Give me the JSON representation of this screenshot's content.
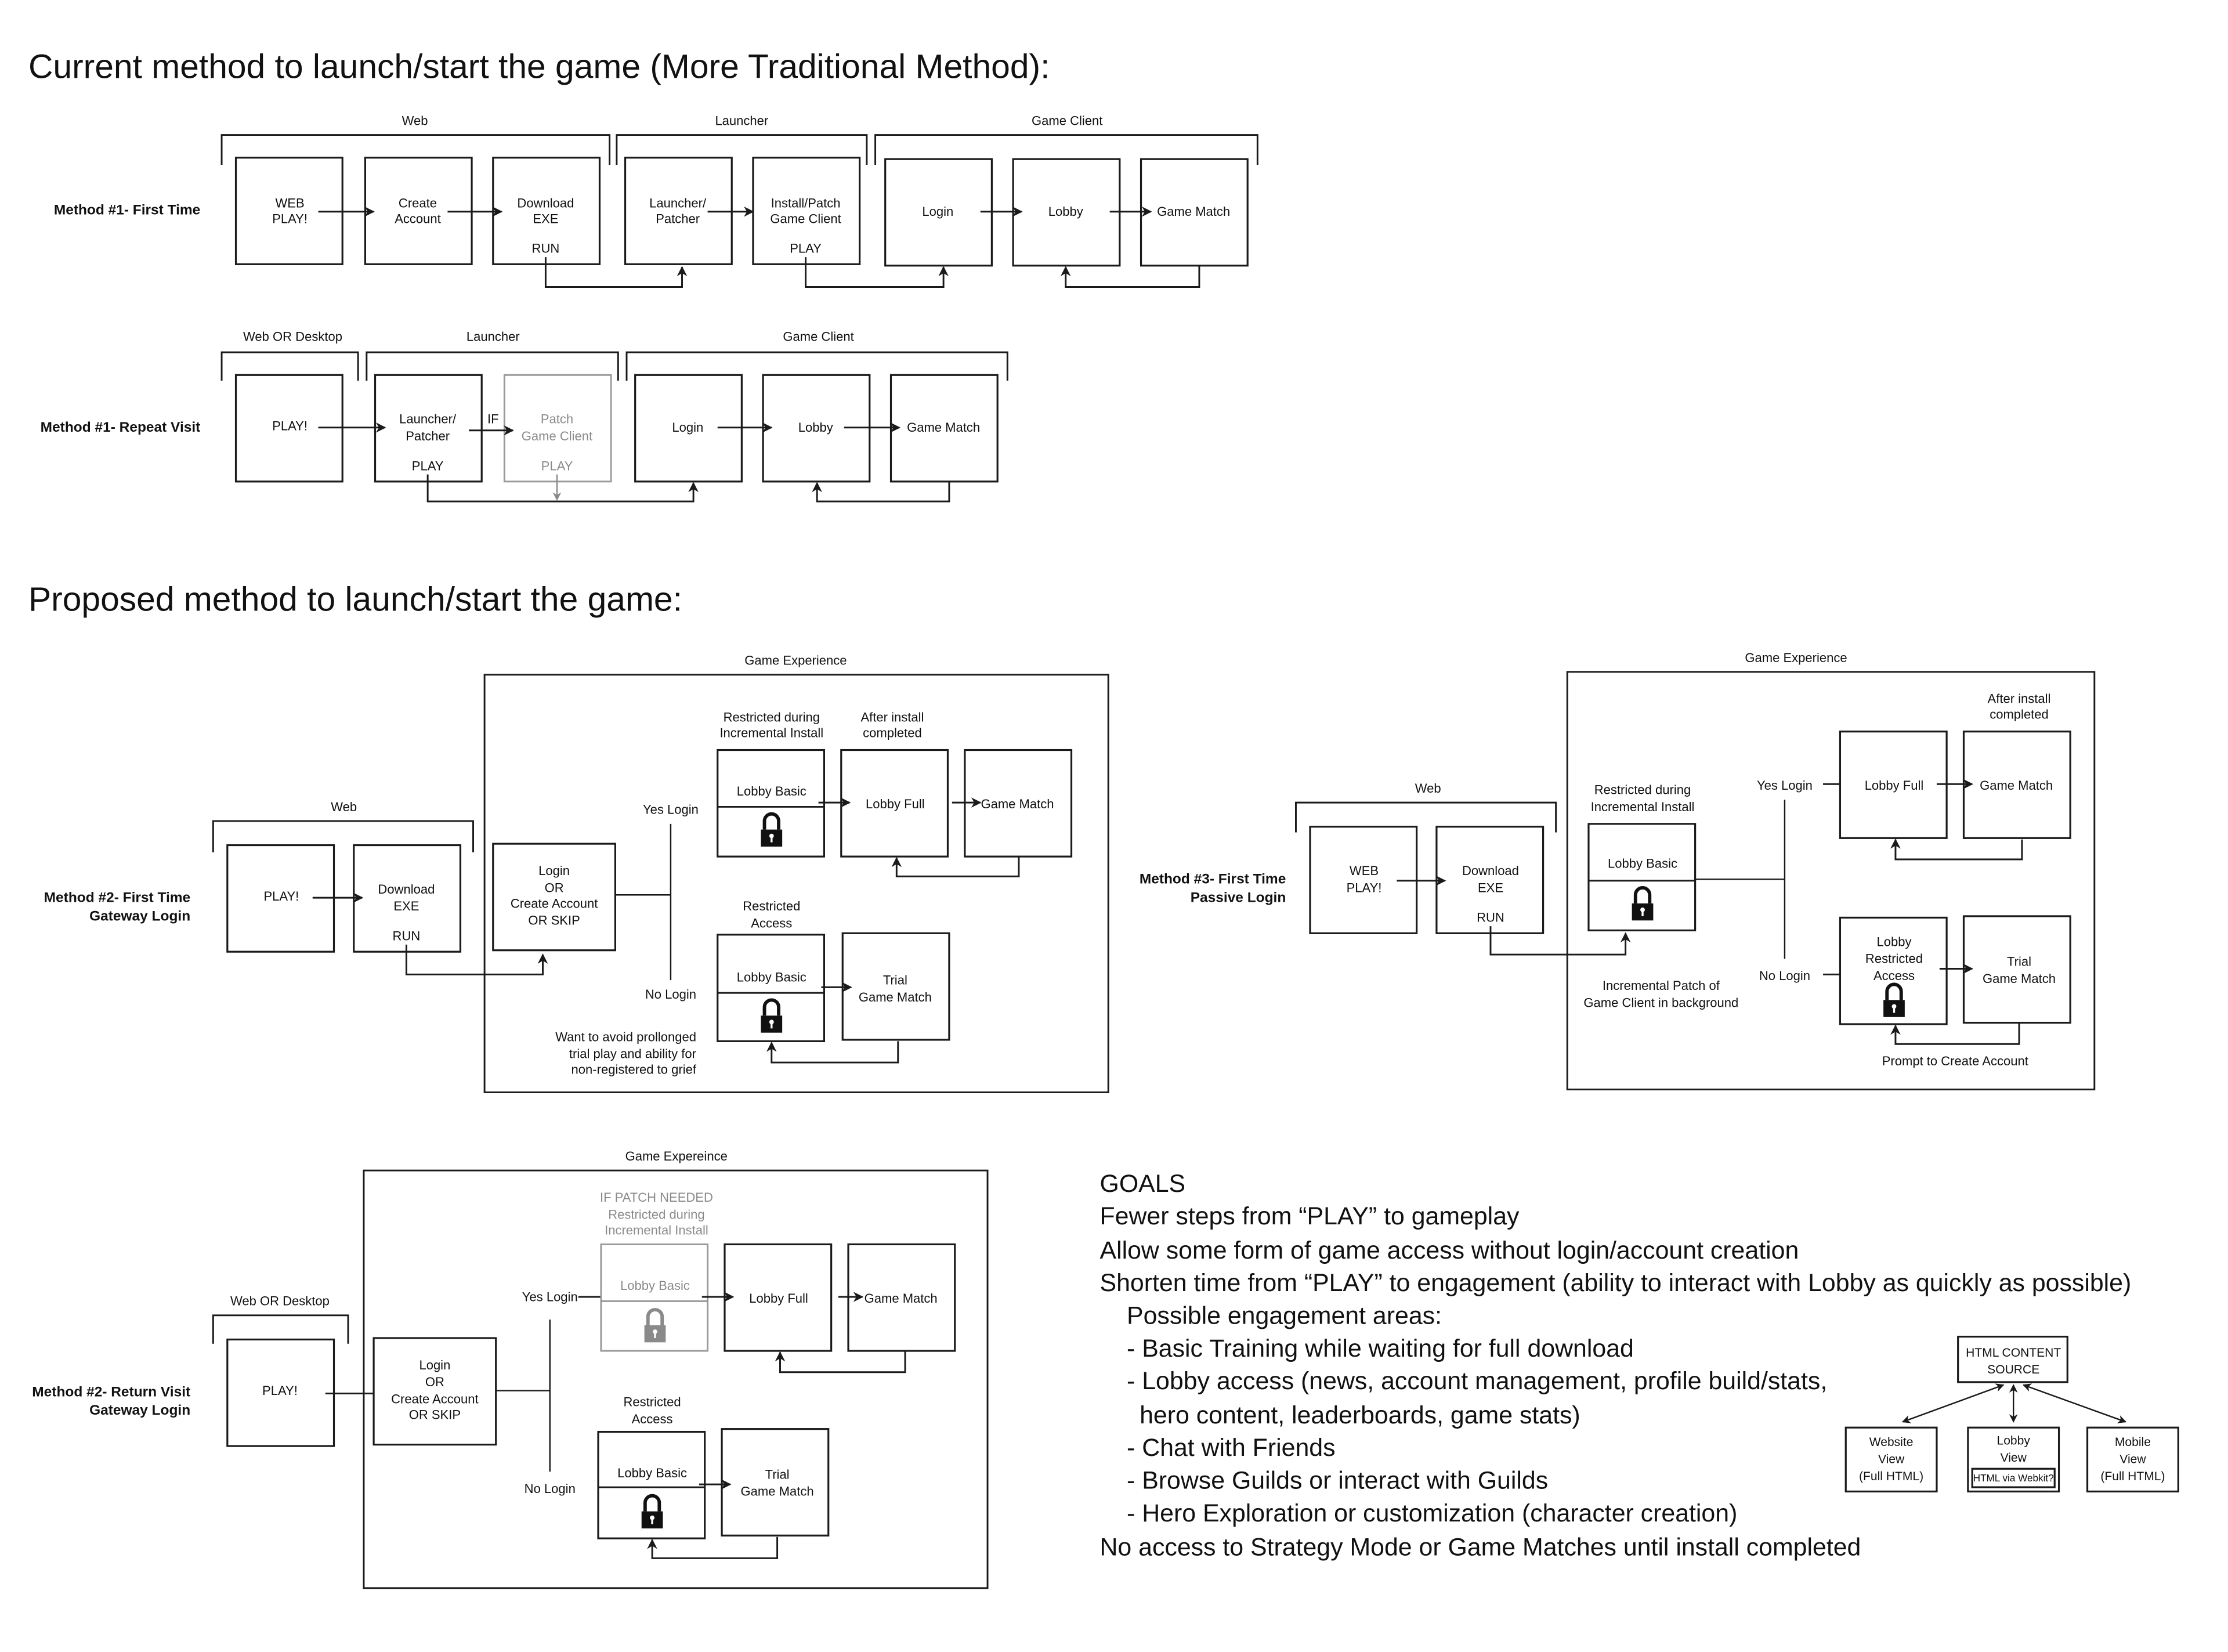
{
  "sections": {
    "current_title": "Current method to launch/start the game (More Traditional Method):",
    "proposed_title": "Proposed method to launch/start the game:"
  },
  "method1_first": {
    "label": "Method #1- First Time",
    "groups": [
      "Web",
      "Launcher",
      "Game Client"
    ],
    "boxes": [
      {
        "line1": "WEB",
        "line2": "PLAY!",
        "footer": ""
      },
      {
        "line1": "Create",
        "line2": "Account",
        "footer": ""
      },
      {
        "line1": "Download",
        "line2": "EXE",
        "footer": "RUN"
      },
      {
        "line1": "Launcher/",
        "line2": "Patcher",
        "footer": ""
      },
      {
        "line1": "Install/Patch",
        "line2": "Game Client",
        "footer": "PLAY"
      },
      {
        "line1": "Login",
        "line2": "",
        "footer": ""
      },
      {
        "line1": "Lobby",
        "line2": "",
        "footer": ""
      },
      {
        "line1": "Game Match",
        "line2": "",
        "footer": ""
      }
    ]
  },
  "method1_repeat": {
    "label": "Method #1- Repeat Visit",
    "groups": [
      "Web OR Desktop",
      "Launcher",
      "Game Client"
    ],
    "if_label": "IF",
    "boxes": [
      {
        "line1": "PLAY!",
        "line2": "",
        "footer": "",
        "dimmed": false
      },
      {
        "line1": "Launcher/",
        "line2": "Patcher",
        "footer": "PLAY",
        "dimmed": false
      },
      {
        "line1": "Patch",
        "line2": "Game Client",
        "footer": "PLAY",
        "dimmed": true
      },
      {
        "line1": "Login",
        "line2": "",
        "footer": "",
        "dimmed": false
      },
      {
        "line1": "Lobby",
        "line2": "",
        "footer": "",
        "dimmed": false
      },
      {
        "line1": "Game Match",
        "line2": "",
        "footer": "",
        "dimmed": false
      }
    ]
  },
  "method2_first": {
    "label_line1": "Method #2- First Time",
    "label_line2": "Gateway Login",
    "web_group": "Web",
    "experience_label": "Game Experience",
    "play": "PLAY!",
    "download": {
      "line1": "Download",
      "line2": "EXE",
      "footer": "RUN"
    },
    "login": {
      "lines": [
        "Login",
        "OR",
        "Create Account",
        "OR SKIP"
      ]
    },
    "yes_login": "Yes Login",
    "no_login": "No Login",
    "restricted_install": {
      "line1": "Restricted during",
      "line2": "Incremental Install"
    },
    "after_install": {
      "line1": "After install",
      "line2": "completed"
    },
    "restricted_access": {
      "line1": "Restricted",
      "line2": "Access"
    },
    "lobby_basic": "Lobby Basic",
    "lobby_full": "Lobby Full",
    "game_match": "Game Match",
    "trial": {
      "line1": "Trial",
      "line2": "Game Match"
    },
    "note": [
      "Want to avoid prollonged",
      "trial play and ability for",
      "non-registered to grief"
    ]
  },
  "method3_first": {
    "label_line1": "Method #3- First Time",
    "label_line2": "Passive Login",
    "web_group": "Web",
    "experience_label": "Game Experience",
    "web_play": {
      "line1": "WEB",
      "line2": "PLAY!"
    },
    "download": {
      "line1": "Download",
      "line2": "EXE",
      "footer": "RUN"
    },
    "restricted_install": {
      "line1": "Restricted during",
      "line2": "Incremental Install"
    },
    "lobby_basic": "Lobby Basic",
    "yes_login": "Yes Login",
    "no_login": "No Login",
    "after_install": {
      "line1": "After install",
      "line2": "completed"
    },
    "lobby_full": "Lobby Full",
    "game_match": "Game Match",
    "lobby_restricted": {
      "line1": "Lobby",
      "line2": "Restricted",
      "line3": "Access"
    },
    "trial": {
      "line1": "Trial",
      "line2": "Game Match"
    },
    "patch_note": {
      "line1": "Incremental Patch of",
      "line2": "Game Client in background"
    },
    "prompt": "Prompt to Create Account"
  },
  "method2_return": {
    "label_line1": "Method #2- Return Visit",
    "label_line2": "Gateway Login",
    "group": "Web OR Desktop",
    "experience_label": "Game Expereince",
    "play": "PLAY!",
    "login": {
      "lines": [
        "Login",
        "OR",
        "Create Account",
        "OR SKIP"
      ]
    },
    "yes_login": "Yes Login",
    "no_login": "No Login",
    "patch_needed": {
      "line1": "IF PATCH NEEDED",
      "line2": "Restricted during",
      "line3": "Incremental Install"
    },
    "lobby_basic_dim": "Lobby Basic",
    "lobby_full": "Lobby Full",
    "game_match": "Game Match",
    "restricted_access": {
      "line1": "Restricted",
      "line2": "Access"
    },
    "lobby_basic": "Lobby Basic",
    "trial": {
      "line1": "Trial",
      "line2": "Game Match"
    }
  },
  "goals": {
    "title": "GOALS",
    "lines": [
      "Fewer steps  from “PLAY” to gameplay",
      "Allow some form of game access without login/account creation",
      "Shorten time from “PLAY” to engagement (ability to interact with Lobby as quickly as possible)",
      "Possible engagement areas:",
      "- Basic Training while waiting for full download",
      "- Lobby access (news, account management, profile build/stats,",
      "hero content, leaderboards, game stats)",
      "- Chat with Friends",
      "- Browse Guilds or interact with Guilds",
      "- Hero Exploration or customization (character creation)",
      "No access to Strategy Mode or Game Matches until install completed"
    ]
  },
  "html_diagram": {
    "source": {
      "line1": "HTML CONTENT",
      "line2": "SOURCE"
    },
    "website": {
      "line1": "Website",
      "line2": "View",
      "line3": "(Full HTML)"
    },
    "lobby": {
      "line1": "Lobby",
      "line2": "View",
      "inner": "HTML via Webkit?"
    },
    "mobile": {
      "line1": "Mobile",
      "line2": "View",
      "line3": "(Full HTML)"
    }
  },
  "icons": {
    "lock": "padlock-icon",
    "arrow": "arrow-right-icon"
  }
}
